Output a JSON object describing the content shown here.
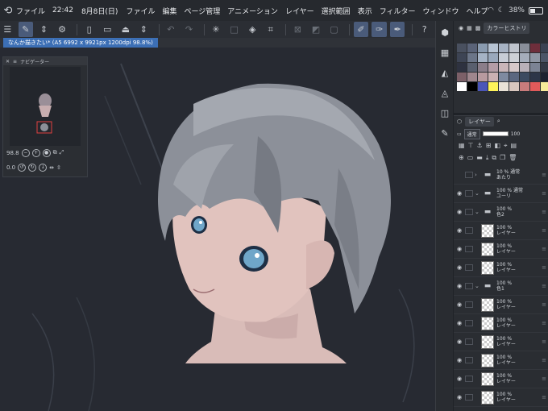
{
  "status": {
    "app_icon": "clip-studio-logo-icon",
    "time": "22:42",
    "date": "8月8日(日)",
    "battery": "38%",
    "battery_level": 0.38
  },
  "menu": [
    "ファイル",
    "編集",
    "ページ管理",
    "アニメーション",
    "レイヤー",
    "選択範囲",
    "表示",
    "フィルター",
    "ウィンドウ",
    "ヘルプ"
  ],
  "document": {
    "tab_title": "なんか描きたい* (A5 6992 x 9921px 1200dpi 98.8%)"
  },
  "navigator": {
    "title": "ナビゲーター",
    "zoom": "98.8",
    "rotation": "0.0"
  },
  "color_history": {
    "title": "カラーヒストリ",
    "swatches": [
      "#49505f",
      "#5a6378",
      "#8a9bb0",
      "#b7c4d4",
      "#a7b3c4",
      "#bfc4cd",
      "#8a8f9a",
      "#6e2e3b",
      "#3b4252",
      "#3d4454",
      "#6b7588",
      "#a5b3c5",
      "#9aa9bc",
      "#c7cdd6",
      "#cdd0d6",
      "#a5adbb",
      "#8f96a4",
      "#4c5567",
      "#2e3240",
      "#595f6e",
      "#8b7e8a",
      "#b49da6",
      "#c9b6b9",
      "#d6c8c9",
      "#b9b0b8",
      "#7c8394",
      "#333845",
      "#7c6068",
      "#9f868d",
      "#b89a9f",
      "#cbb1b3",
      "#7e8aa0",
      "#5b6780",
      "#3c4a60",
      "#2d3548",
      "#1d2230",
      "#ffffff",
      "#000000",
      "#4b56b8",
      "#fff35a",
      "#e9e2d7",
      "#d9c7bf",
      "#c97c7c",
      "#e05a5a",
      "#f7eb9a"
    ]
  },
  "layers": {
    "tab_label": "レイヤー",
    "blend_mode": "通常",
    "opacity": "100",
    "rows": [
      {
        "type": "folder",
        "line1": "10 % 通常",
        "line2": "あたり",
        "visible": false
      },
      {
        "type": "folder",
        "line1": "100 % 通常",
        "line2": "ユーリ",
        "visible": true
      },
      {
        "type": "folder",
        "line1": "100 %",
        "line2": "色2",
        "visible": true
      },
      {
        "type": "layer",
        "line1": "100 %",
        "line2": "レイヤー",
        "visible": true
      },
      {
        "type": "layer",
        "line1": "100 %",
        "line2": "レイヤー",
        "visible": true
      },
      {
        "type": "layer",
        "line1": "100 %",
        "line2": "レイヤー",
        "visible": true
      },
      {
        "type": "folder",
        "line1": "100 %",
        "line2": "色1",
        "visible": true
      },
      {
        "type": "layer",
        "line1": "100 %",
        "line2": "レイヤー",
        "visible": true
      },
      {
        "type": "layer",
        "line1": "100 %",
        "line2": "レイヤー",
        "visible": true
      },
      {
        "type": "layer",
        "line1": "100 %",
        "line2": "レイヤー",
        "visible": true
      },
      {
        "type": "layer",
        "line1": "100 %",
        "line2": "レイヤー",
        "visible": true
      },
      {
        "type": "layer",
        "line1": "100 %",
        "line2": "レイヤー",
        "visible": true
      },
      {
        "type": "layer",
        "line1": "100 %",
        "line2": "レイヤー",
        "visible": true
      }
    ]
  }
}
